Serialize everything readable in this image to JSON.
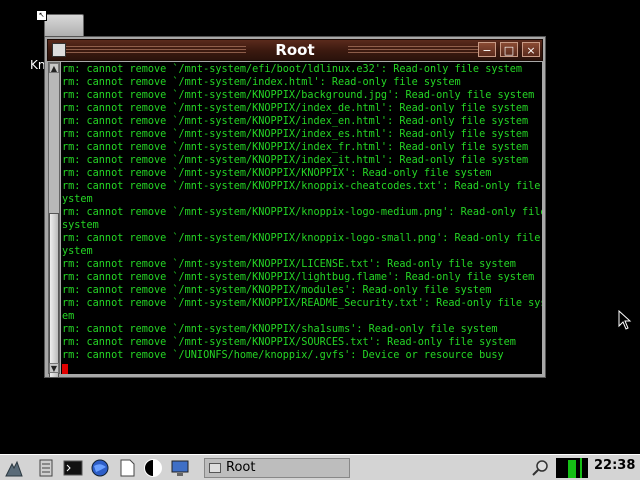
{
  "desktop": {
    "icon_label": "Kn"
  },
  "window": {
    "title": "Root",
    "buttons": {
      "minimize": "−",
      "maximize": "□",
      "close": "×"
    },
    "terminal_lines": [
      "rm: cannot remove `/mnt-system/efi/boot/ldlinux.e32': Read-only file system",
      "rm: cannot remove `/mnt-system/index.html': Read-only file system",
      "rm: cannot remove `/mnt-system/KNOPPIX/background.jpg': Read-only file system",
      "rm: cannot remove `/mnt-system/KNOPPIX/index_de.html': Read-only file system",
      "rm: cannot remove `/mnt-system/KNOPPIX/index_en.html': Read-only file system",
      "rm: cannot remove `/mnt-system/KNOPPIX/index_es.html': Read-only file system",
      "rm: cannot remove `/mnt-system/KNOPPIX/index_fr.html': Read-only file system",
      "rm: cannot remove `/mnt-system/KNOPPIX/index_it.html': Read-only file system",
      "rm: cannot remove `/mnt-system/KNOPPIX/KNOPPIX': Read-only file system",
      "rm: cannot remove `/mnt-system/KNOPPIX/knoppix-cheatcodes.txt': Read-only file s",
      "ystem",
      "rm: cannot remove `/mnt-system/KNOPPIX/knoppix-logo-medium.png': Read-only file",
      "system",
      "rm: cannot remove `/mnt-system/KNOPPIX/knoppix-logo-small.png': Read-only file s",
      "ystem",
      "rm: cannot remove `/mnt-system/KNOPPIX/LICENSE.txt': Read-only file system",
      "rm: cannot remove `/mnt-system/KNOPPIX/lightbug.flame': Read-only file system",
      "rm: cannot remove `/mnt-system/KNOPPIX/modules': Read-only file system",
      "rm: cannot remove `/mnt-system/KNOPPIX/README_Security.txt': Read-only file syst",
      "em",
      "rm: cannot remove `/mnt-system/KNOPPIX/sha1sums': Read-only file system",
      "rm: cannot remove `/mnt-system/KNOPPIX/SOURCES.txt': Read-only file system",
      "rm: cannot remove `/UNIONFS/home/knoppix/.gvfs': Device or resource busy"
    ]
  },
  "taskbar": {
    "task_label": "Root",
    "clock": "22:38",
    "icons": [
      "start-menu-icon",
      "file-manager-icon",
      "terminal-icon",
      "browser-icon",
      "text-editor-icon",
      "display-settings-icon",
      "desktop-icon"
    ]
  },
  "colors": {
    "terminal_text": "#25d625",
    "terminal_bg": "#000000",
    "titlebar": "#3d1a10",
    "cursor": "#e00000"
  }
}
